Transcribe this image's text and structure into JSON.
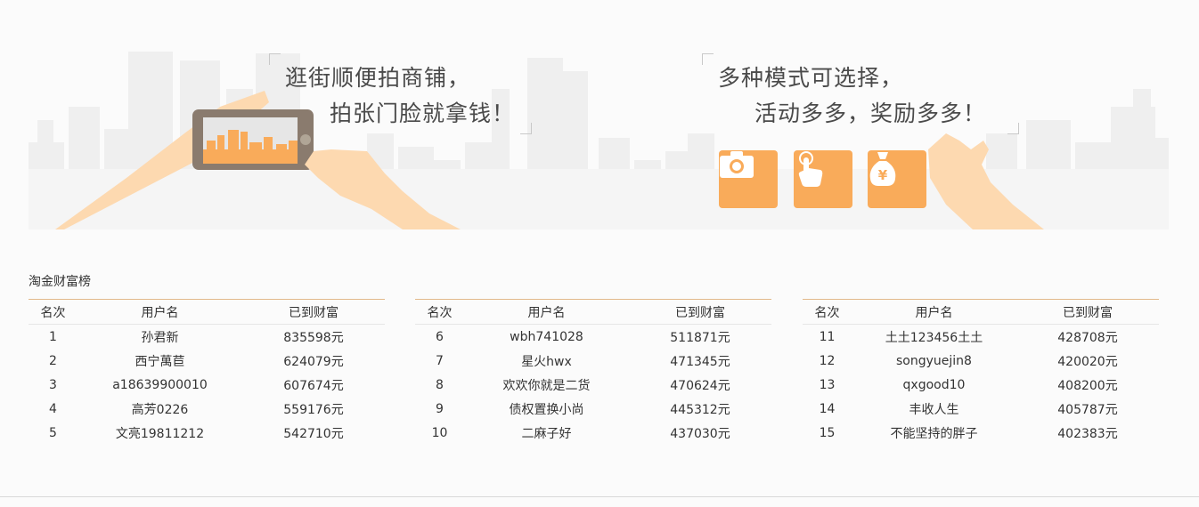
{
  "banner": {
    "slogan_left_line1": "逛街顺便拍商铺，",
    "slogan_left_line2": "拍张门脸就拿钱！",
    "slogan_right_line1": "多种模式可选择，",
    "slogan_right_line2": "活动多多，奖励多多！",
    "features": [
      {
        "icon": "camera-icon"
      },
      {
        "icon": "tap-hand-icon"
      },
      {
        "icon": "money-bag-icon",
        "glyph": "¥"
      }
    ],
    "colors": {
      "accent": "#f9ab5a",
      "skyline": "#ebebeb",
      "hand": "#fdd9b0",
      "phone": "#8a7b6e"
    }
  },
  "leaderboard": {
    "title": "淘金财富榜",
    "headers": {
      "rank": "名次",
      "user": "用户名",
      "wealth": "已到财富"
    },
    "tables": [
      {
        "rows": [
          {
            "rank": "1",
            "user": "孙君新",
            "wealth": "835598元"
          },
          {
            "rank": "2",
            "user": "西宁萬苣",
            "wealth": "624079元"
          },
          {
            "rank": "3",
            "user": "a18639900010",
            "wealth": "607674元"
          },
          {
            "rank": "4",
            "user": "高芳0226",
            "wealth": "559176元"
          },
          {
            "rank": "5",
            "user": "文亮19811212",
            "wealth": "542710元"
          }
        ]
      },
      {
        "rows": [
          {
            "rank": "6",
            "user": "wbh741028",
            "wealth": "511871元"
          },
          {
            "rank": "7",
            "user": "星火hwx",
            "wealth": "471345元"
          },
          {
            "rank": "8",
            "user": "欢欢你就是二货",
            "wealth": "470624元"
          },
          {
            "rank": "9",
            "user": "债权置换小尚",
            "wealth": "445312元"
          },
          {
            "rank": "10",
            "user": "二麻子好",
            "wealth": "437030元"
          }
        ]
      },
      {
        "rows": [
          {
            "rank": "11",
            "user": "土土123456土土",
            "wealth": "428708元"
          },
          {
            "rank": "12",
            "user": "songyuejin8",
            "wealth": "420020元"
          },
          {
            "rank": "13",
            "user": "qxgood10",
            "wealth": "408200元"
          },
          {
            "rank": "14",
            "user": "丰收人生",
            "wealth": "405787元"
          },
          {
            "rank": "15",
            "user": "不能坚持的胖子",
            "wealth": "402383元"
          }
        ]
      }
    ]
  }
}
